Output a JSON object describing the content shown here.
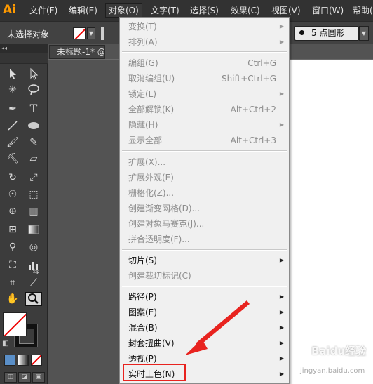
{
  "app": {
    "logo": "Ai"
  },
  "menubar": {
    "items": [
      "文件(F)",
      "编辑(E)",
      "对象(O)",
      "文字(T)",
      "选择(S)",
      "效果(C)",
      "视图(V)",
      "窗口(W)",
      "帮助(H)"
    ],
    "active": "对象(O)"
  },
  "controlbar": {
    "selection_label": "未选择对象",
    "brush_size": "5",
    "brush_shape": "点圆形"
  },
  "document": {
    "tab_title": "未标题-1* @"
  },
  "object_menu": {
    "items": [
      {
        "label": "变换(T)",
        "shortcut": "",
        "submenu": true,
        "enabled": false
      },
      {
        "label": "排列(A)",
        "shortcut": "",
        "submenu": true,
        "enabled": false
      },
      {
        "label": "编组(G)",
        "shortcut": "Ctrl+G",
        "submenu": false,
        "enabled": false
      },
      {
        "label": "取消编组(U)",
        "shortcut": "Shift+Ctrl+G",
        "submenu": false,
        "enabled": false
      },
      {
        "label": "锁定(L)",
        "shortcut": "",
        "submenu": true,
        "enabled": false
      },
      {
        "label": "全部解锁(K)",
        "shortcut": "Alt+Ctrl+2",
        "submenu": false,
        "enabled": false
      },
      {
        "label": "隐藏(H)",
        "shortcut": "",
        "submenu": true,
        "enabled": false
      },
      {
        "label": "显示全部",
        "shortcut": "Alt+Ctrl+3",
        "submenu": false,
        "enabled": false
      },
      {
        "label": "扩展(X)...",
        "shortcut": "",
        "submenu": false,
        "enabled": false
      },
      {
        "label": "扩展外观(E)",
        "shortcut": "",
        "submenu": false,
        "enabled": false
      },
      {
        "label": "栅格化(Z)...",
        "shortcut": "",
        "submenu": false,
        "enabled": false
      },
      {
        "label": "创建渐变网格(D)...",
        "shortcut": "",
        "submenu": false,
        "enabled": false
      },
      {
        "label": "创建对象马赛克(J)...",
        "shortcut": "",
        "submenu": false,
        "enabled": false
      },
      {
        "label": "拼合透明度(F)...",
        "shortcut": "",
        "submenu": false,
        "enabled": false
      },
      {
        "label": "切片(S)",
        "shortcut": "",
        "submenu": true,
        "enabled": true
      },
      {
        "label": "创建裁切标记(C)",
        "shortcut": "",
        "submenu": false,
        "enabled": false
      },
      {
        "label": "路径(P)",
        "shortcut": "",
        "submenu": true,
        "enabled": true
      },
      {
        "label": "图案(E)",
        "shortcut": "",
        "submenu": true,
        "enabled": true
      },
      {
        "label": "混合(B)",
        "shortcut": "",
        "submenu": true,
        "enabled": true
      },
      {
        "label": "封套扭曲(V)",
        "shortcut": "",
        "submenu": true,
        "enabled": true
      },
      {
        "label": "透视(P)",
        "shortcut": "",
        "submenu": true,
        "enabled": true
      },
      {
        "label": "实时上色(N)",
        "shortcut": "",
        "submenu": true,
        "enabled": true
      }
    ],
    "highlighted": "实时上色(N)"
  },
  "watermark": {
    "text": "Baidu经验",
    "url": "jingyan.baidu.com"
  },
  "colors": {
    "accent_orange": "#ff9a00",
    "annotation_red": "#e8231f",
    "menu_bg": "#f0f0f0"
  }
}
